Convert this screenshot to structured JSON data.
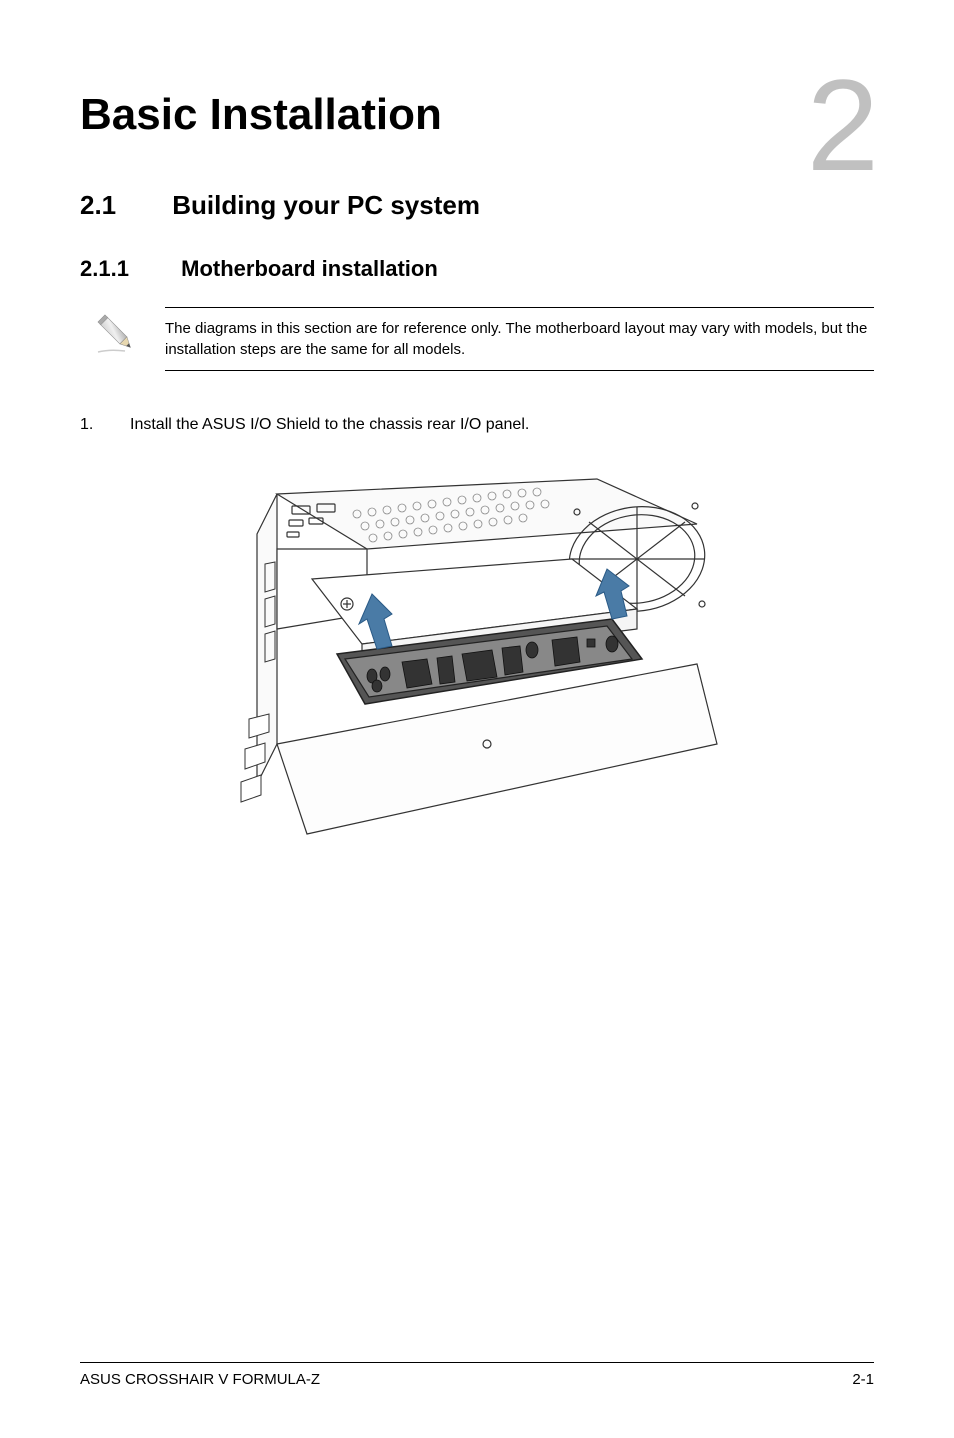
{
  "chapter": {
    "title": "Basic Installation",
    "number": "2"
  },
  "section": {
    "number": "2.1",
    "title": "Building your PC system"
  },
  "subsection": {
    "number": "2.1.1",
    "title": "Motherboard installation"
  },
  "note": {
    "text": "The diagrams in this section are for reference only. The motherboard layout may vary with models, but the installation steps are the same for all models."
  },
  "instructions": [
    {
      "number": "1.",
      "text": "Install the ASUS I/O Shield to the chassis rear I/O panel."
    }
  ],
  "footer": {
    "left": "ASUS CROSSHAIR V FORMULA-Z",
    "right": "2-1"
  }
}
